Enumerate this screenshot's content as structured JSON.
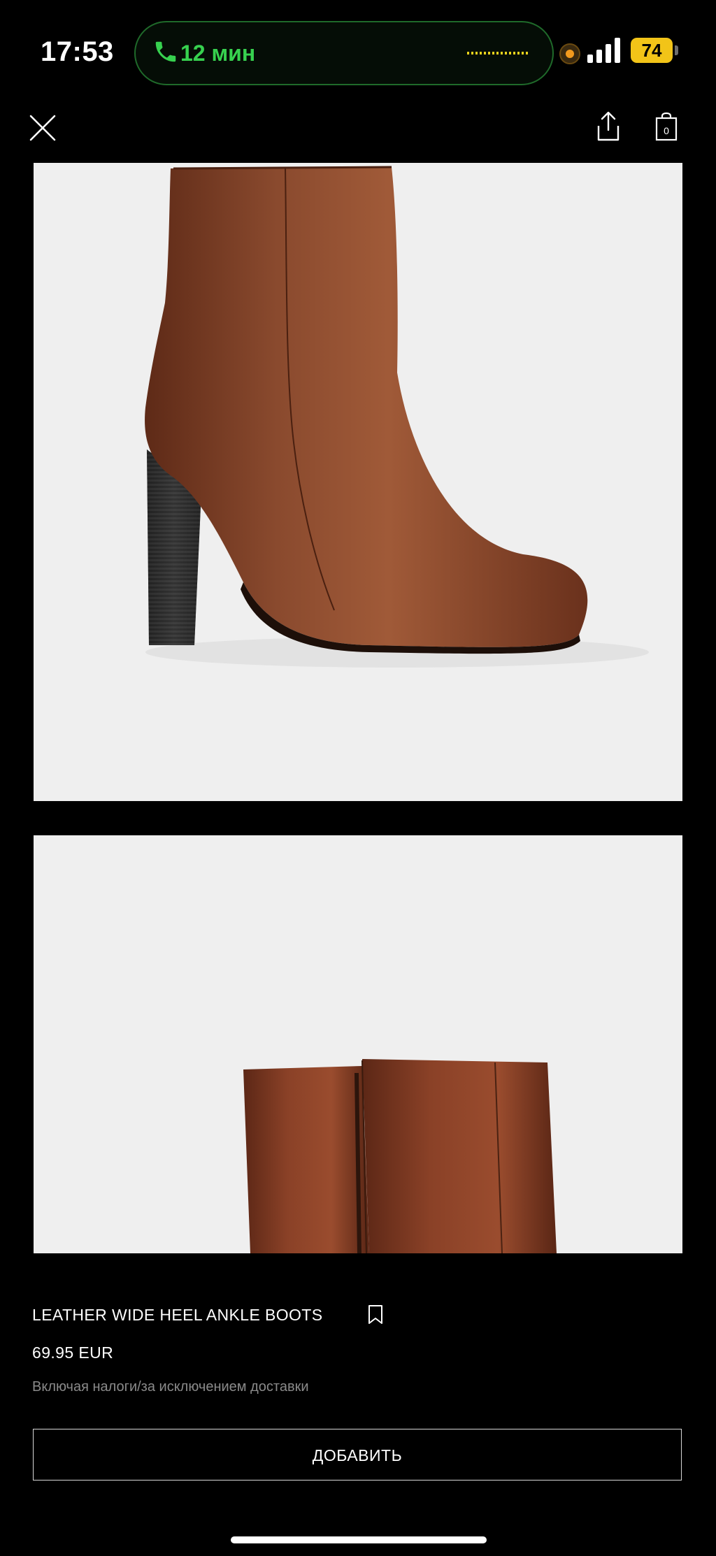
{
  "status_bar": {
    "time": "17:53",
    "call_duration": "12 мин",
    "battery_level": "74",
    "call_color": "#37d14f",
    "battery_color": "#f2c418",
    "recording_dot_color": "#f29a1e"
  },
  "toolbar": {
    "close_icon": "close-icon",
    "share_icon": "share-icon",
    "bag_icon": "shopping-bag-icon",
    "bag_count": "0"
  },
  "product": {
    "name": "LEATHER WIDE HEEL ANKLE BOOTS",
    "price": "69.95 EUR",
    "tax_note": "Включая налоги/за исключением доставки",
    "add_button_label": "ДОБАВИТЬ",
    "boot_color": "#7b3b22"
  }
}
